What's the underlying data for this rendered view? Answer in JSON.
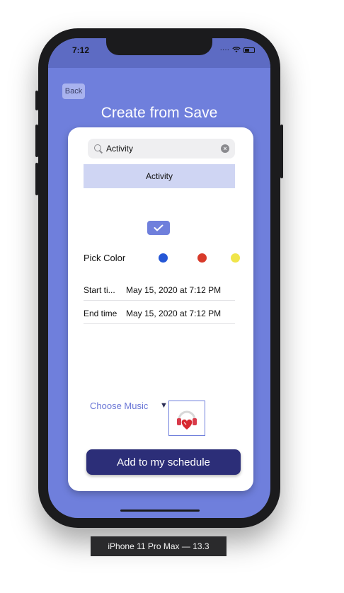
{
  "status_bar": {
    "time": "7:12"
  },
  "nav": {
    "back_label": "Back",
    "title": "Create from Save"
  },
  "search": {
    "value": "Activity",
    "placeholder": ""
  },
  "results": [
    {
      "label": "Activity"
    }
  ],
  "pick_color": {
    "label": "Pick Color",
    "colors": [
      "#2557d6",
      "#d83a2a",
      "#f0e54a"
    ]
  },
  "start": {
    "label": "Start ti...",
    "value": "May 15, 2020 at 7:12 PM"
  },
  "end": {
    "label": "End time",
    "value": "May 15, 2020 at 7:12 PM"
  },
  "music": {
    "label": "Choose Music",
    "arrow": "▼"
  },
  "add_button": {
    "label": "Add to my schedule"
  },
  "device": {
    "label": "iPhone 11 Pro Max — 13.3"
  },
  "colors": {
    "accent": "#6f7fdc",
    "button": "#2c2e78",
    "header": "#5d6bc3"
  }
}
